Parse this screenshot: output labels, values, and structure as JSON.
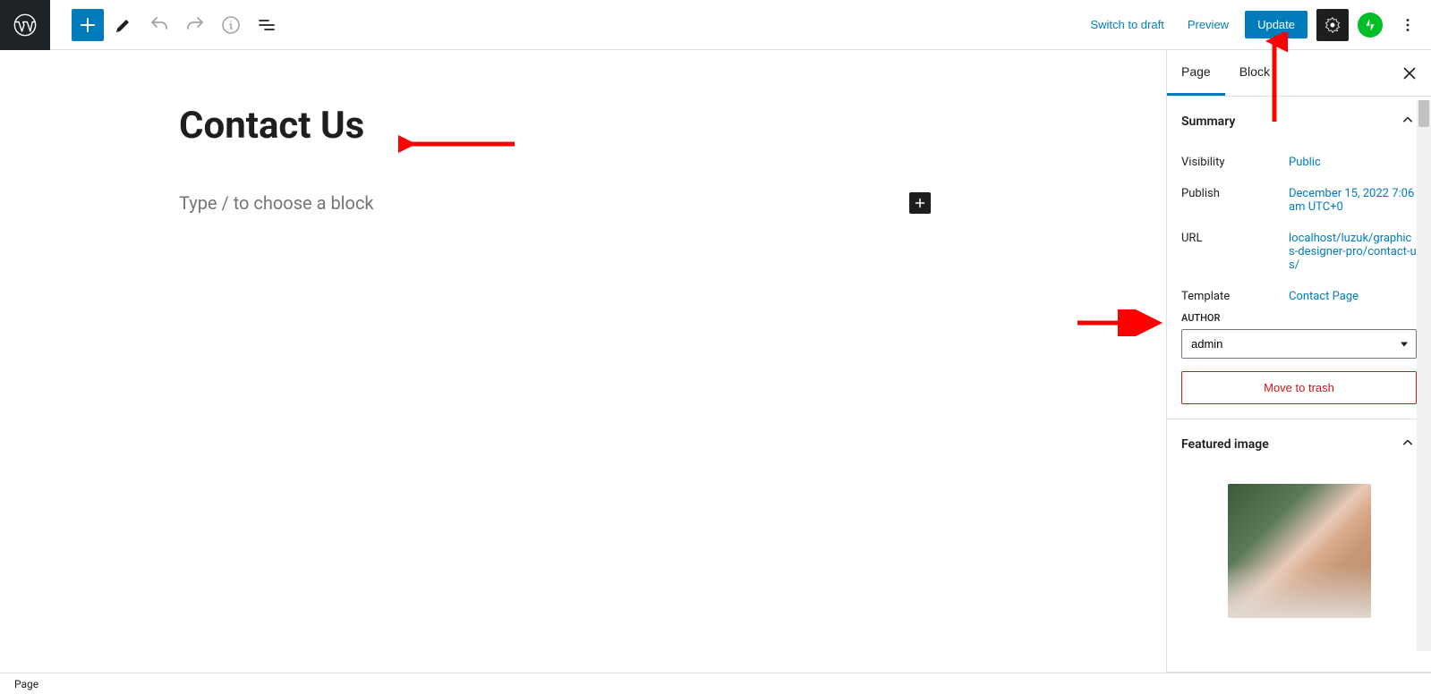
{
  "toolbar": {
    "switch_to_draft": "Switch to draft",
    "preview": "Preview",
    "update": "Update"
  },
  "editor": {
    "page_title": "Contact Us",
    "block_placeholder": "Type / to choose a block"
  },
  "sidebar": {
    "tabs": {
      "page": "Page",
      "block": "Block"
    },
    "summary": {
      "title": "Summary",
      "visibility_label": "Visibility",
      "visibility_value": "Public",
      "publish_label": "Publish",
      "publish_value": "December 15, 2022 7:06 am UTC+0",
      "url_label": "URL",
      "url_value": "localhost/luzuk/graphics-designer-pro/contact-us/",
      "template_label": "Template",
      "template_value": "Contact Page",
      "author_label": "AUTHOR",
      "author_value": "admin",
      "trash": "Move to trash"
    },
    "featured_image": {
      "title": "Featured image"
    }
  },
  "footer": {
    "breadcrumb": "Page"
  }
}
